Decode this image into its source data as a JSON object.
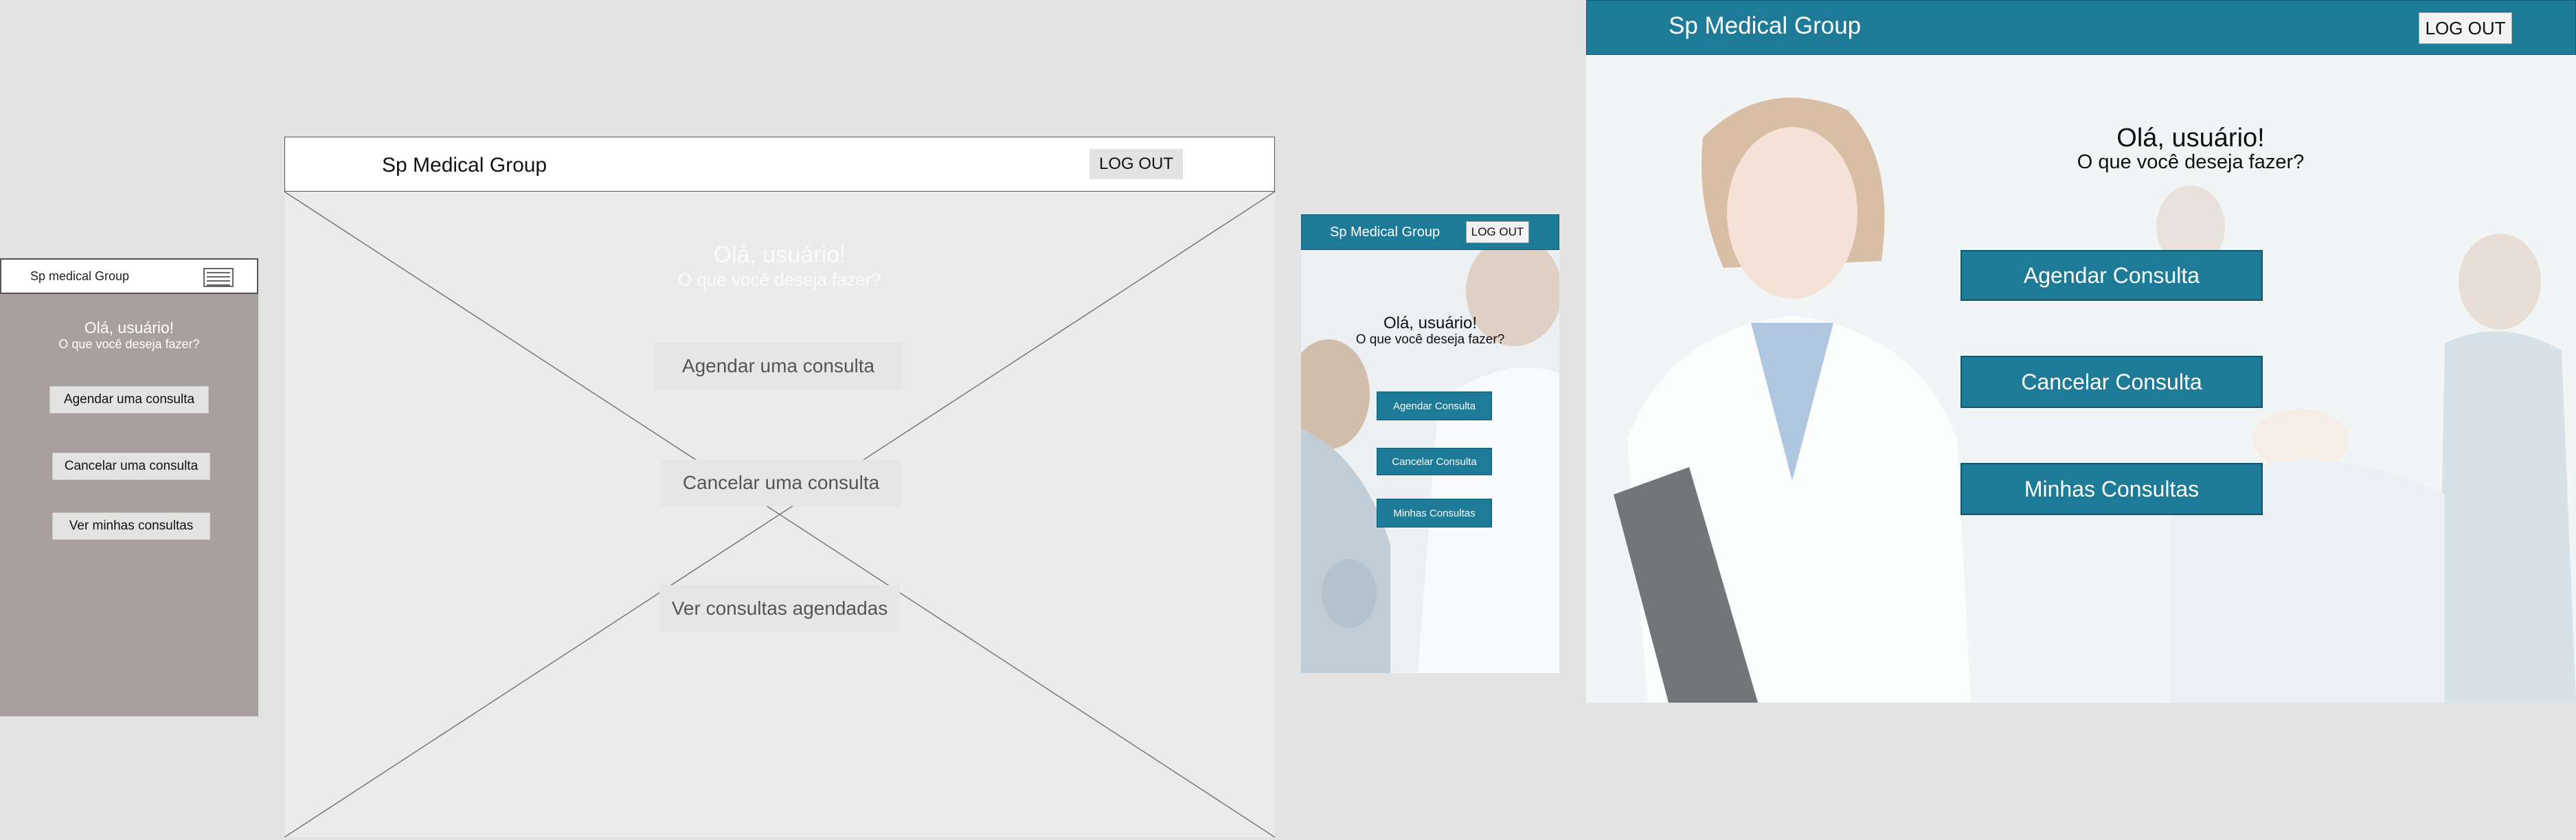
{
  "mobile_wireframe": {
    "title": "Sp medical Group",
    "greeting": "Olá, usuário!",
    "subtitle": "O que você deseja fazer?",
    "buttons": [
      "Agendar uma consulta",
      "Cancelar uma consulta",
      "Ver minhas consultas"
    ]
  },
  "desktop_wireframe": {
    "title": "Sp Medical Group",
    "logout": "LOG OUT",
    "greeting": "Olá, usuário!",
    "subtitle": "O que você deseja fazer?",
    "buttons": [
      "Agendar uma consulta",
      "Cancelar uma consulta",
      "Ver consultas agendadas"
    ]
  },
  "mobile_mockup": {
    "title": "Sp Medical Group",
    "logout": "LOG OUT",
    "greeting": "Olá, usuário!",
    "subtitle": "O que você deseja fazer?",
    "buttons": [
      "Agendar Consulta",
      "Cancelar Consulta",
      "Minhas Consultas"
    ]
  },
  "desktop_mockup": {
    "title": "Sp Medical Group",
    "logout": "LOG OUT",
    "greeting": "Olá, usuário!",
    "subtitle": "O que você deseja fazer?",
    "buttons": [
      "Agendar Consulta",
      "Cancelar Consulta",
      "Minhas Consultas"
    ]
  },
  "colors": {
    "brand_teal": "#1e7b98",
    "wireframe_mobile_bg": "#aa9f9f",
    "canvas_bg": "#e3e3e3"
  }
}
